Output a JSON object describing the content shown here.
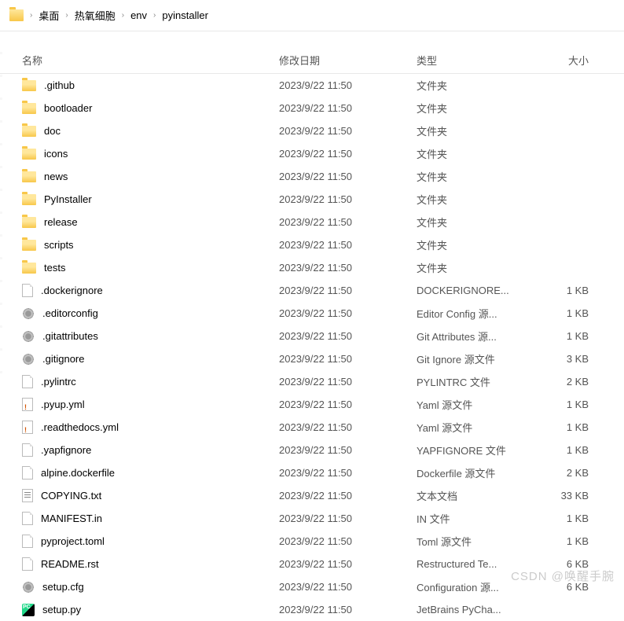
{
  "breadcrumb": {
    "items": [
      "桌面",
      "热氧细胞",
      "env",
      "pyinstaller"
    ],
    "sep": "›"
  },
  "columns": {
    "name": "名称",
    "date": "修改日期",
    "type": "类型",
    "size": "大小"
  },
  "files": [
    {
      "name": ".github",
      "date": "2023/9/22 11:50",
      "type": "文件夹",
      "size": "",
      "icon": "folder"
    },
    {
      "name": "bootloader",
      "date": "2023/9/22 11:50",
      "type": "文件夹",
      "size": "",
      "icon": "folder"
    },
    {
      "name": "doc",
      "date": "2023/9/22 11:50",
      "type": "文件夹",
      "size": "",
      "icon": "folder"
    },
    {
      "name": "icons",
      "date": "2023/9/22 11:50",
      "type": "文件夹",
      "size": "",
      "icon": "folder"
    },
    {
      "name": "news",
      "date": "2023/9/22 11:50",
      "type": "文件夹",
      "size": "",
      "icon": "folder"
    },
    {
      "name": "PyInstaller",
      "date": "2023/9/22 11:50",
      "type": "文件夹",
      "size": "",
      "icon": "folder"
    },
    {
      "name": "release",
      "date": "2023/9/22 11:50",
      "type": "文件夹",
      "size": "",
      "icon": "folder"
    },
    {
      "name": "scripts",
      "date": "2023/9/22 11:50",
      "type": "文件夹",
      "size": "",
      "icon": "folder"
    },
    {
      "name": "tests",
      "date": "2023/9/22 11:50",
      "type": "文件夹",
      "size": "",
      "icon": "folder"
    },
    {
      "name": ".dockerignore",
      "date": "2023/9/22 11:50",
      "type": "DOCKERIGNORE...",
      "size": "1 KB",
      "icon": "file"
    },
    {
      "name": ".editorconfig",
      "date": "2023/9/22 11:50",
      "type": "Editor Config 源...",
      "size": "1 KB",
      "icon": "gear"
    },
    {
      "name": ".gitattributes",
      "date": "2023/9/22 11:50",
      "type": "Git Attributes 源...",
      "size": "1 KB",
      "icon": "gear"
    },
    {
      "name": ".gitignore",
      "date": "2023/9/22 11:50",
      "type": "Git Ignore 源文件",
      "size": "3 KB",
      "icon": "gear"
    },
    {
      "name": ".pylintrc",
      "date": "2023/9/22 11:50",
      "type": "PYLINTRC 文件",
      "size": "2 KB",
      "icon": "file"
    },
    {
      "name": ".pyup.yml",
      "date": "2023/9/22 11:50",
      "type": "Yaml 源文件",
      "size": "1 KB",
      "icon": "yaml"
    },
    {
      "name": ".readthedocs.yml",
      "date": "2023/9/22 11:50",
      "type": "Yaml 源文件",
      "size": "1 KB",
      "icon": "yaml"
    },
    {
      "name": ".yapfignore",
      "date": "2023/9/22 11:50",
      "type": "YAPFIGNORE 文件",
      "size": "1 KB",
      "icon": "file"
    },
    {
      "name": "alpine.dockerfile",
      "date": "2023/9/22 11:50",
      "type": "Dockerfile 源文件",
      "size": "2 KB",
      "icon": "file"
    },
    {
      "name": "COPYING.txt",
      "date": "2023/9/22 11:50",
      "type": "文本文档",
      "size": "33 KB",
      "icon": "txt"
    },
    {
      "name": "MANIFEST.in",
      "date": "2023/9/22 11:50",
      "type": "IN 文件",
      "size": "1 KB",
      "icon": "file"
    },
    {
      "name": "pyproject.toml",
      "date": "2023/9/22 11:50",
      "type": "Toml 源文件",
      "size": "1 KB",
      "icon": "file"
    },
    {
      "name": "README.rst",
      "date": "2023/9/22 11:50",
      "type": "Restructured Te...",
      "size": "6 KB",
      "icon": "file"
    },
    {
      "name": "setup.cfg",
      "date": "2023/9/22 11:50",
      "type": "Configuration 源...",
      "size": "6 KB",
      "icon": "gear"
    },
    {
      "name": "setup.py",
      "date": "2023/9/22 11:50",
      "type": "JetBrains PyCha...",
      "size": "",
      "icon": "pycharm"
    }
  ],
  "watermark": "CSDN @唤醒手腕"
}
